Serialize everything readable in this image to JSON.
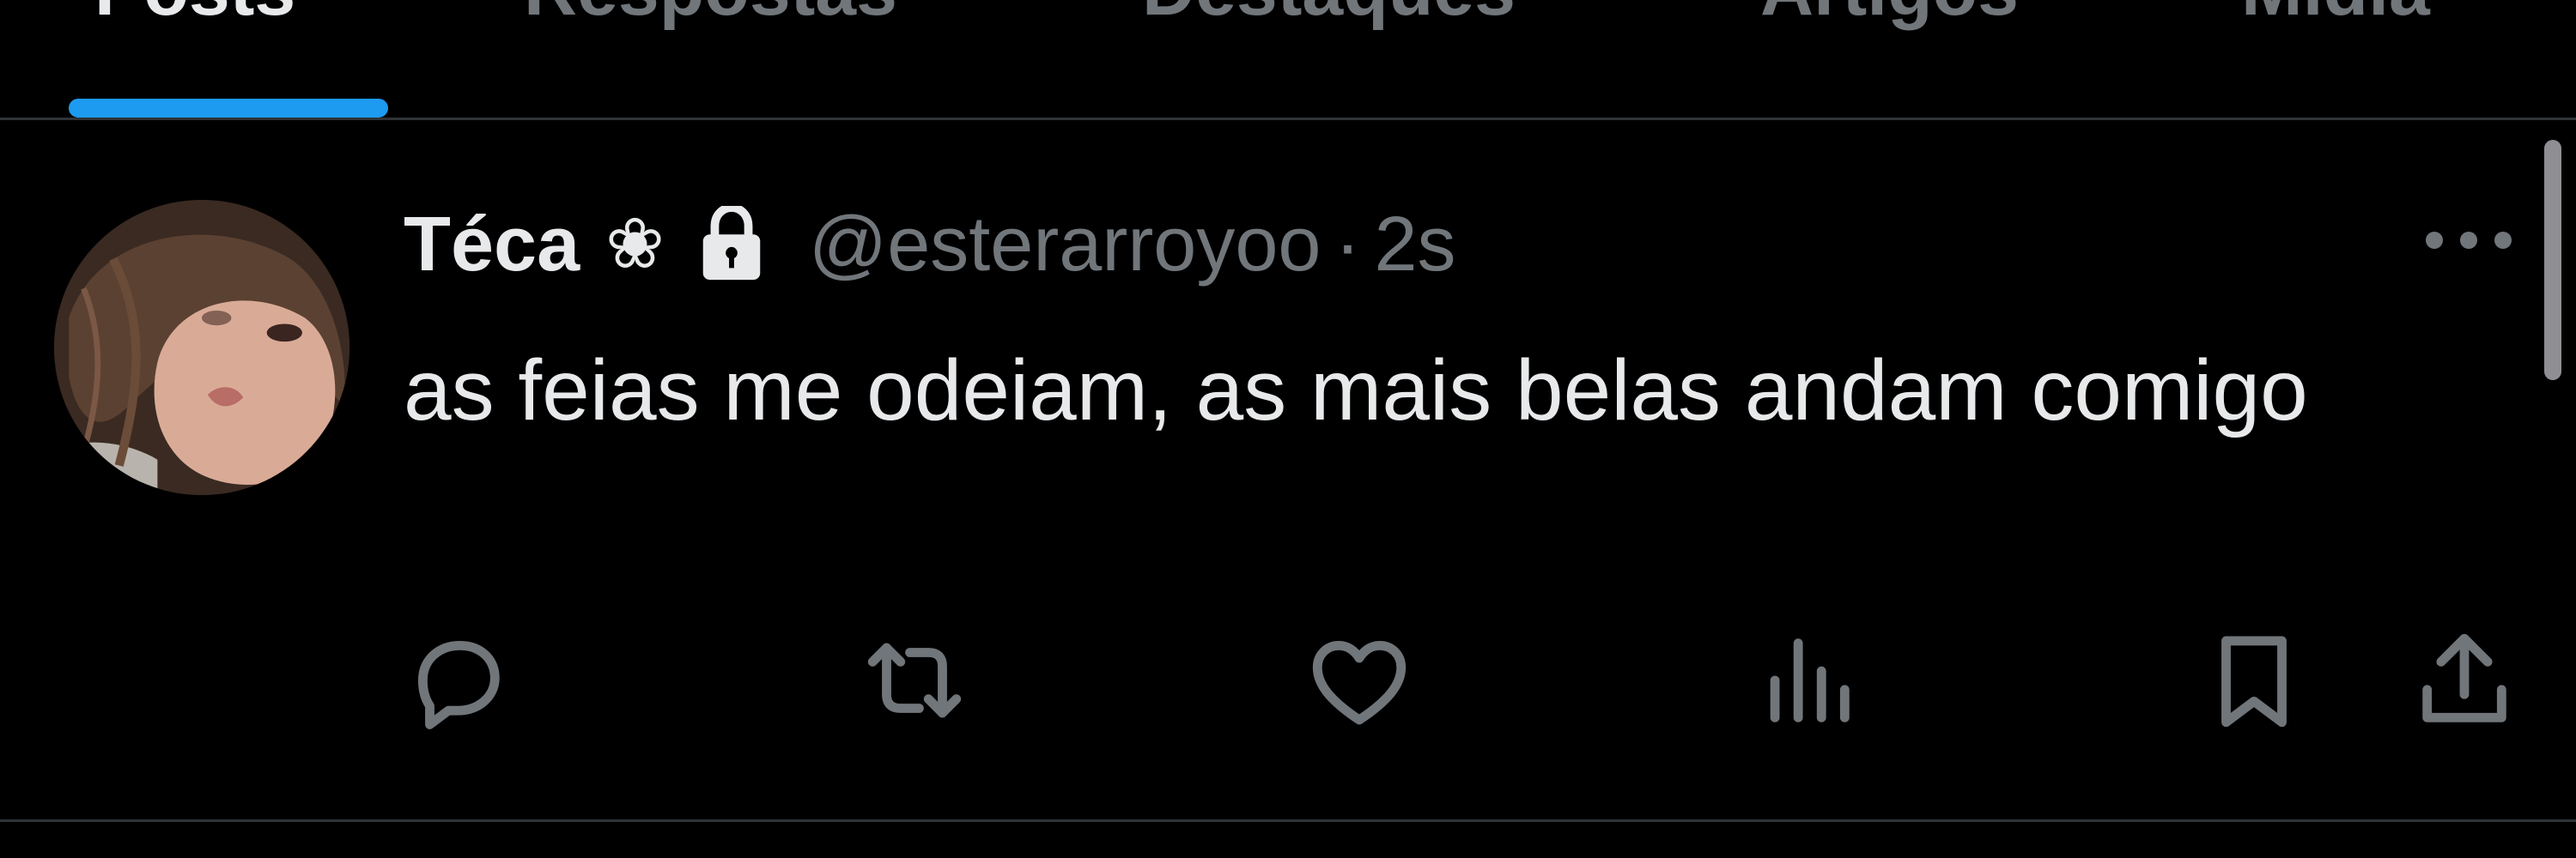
{
  "tabs": [
    {
      "label": "Posts",
      "active": true
    },
    {
      "label": "Respostas",
      "active": false
    },
    {
      "label": "Destaques",
      "active": false
    },
    {
      "label": "Artigos",
      "active": false
    },
    {
      "label": "Mídia",
      "active": false
    }
  ],
  "colors": {
    "background": "#000000",
    "accent": "#1d9bf0",
    "primary_text": "#e7e9ea",
    "secondary_text": "#71767b",
    "divider": "#2f3336"
  },
  "post": {
    "display_name": "Téca",
    "name_emoji": "❀",
    "protected_icon": "lock-icon",
    "handle": "@esterarroyoo",
    "separator": "·",
    "timestamp": "2s",
    "text": "as feias me odeiam, as mais belas andam comigo",
    "more_icon": "more-horizontal-icon",
    "actions": [
      {
        "name": "reply",
        "icon": "reply-icon"
      },
      {
        "name": "repost",
        "icon": "repost-icon"
      },
      {
        "name": "like",
        "icon": "heart-icon"
      },
      {
        "name": "views",
        "icon": "analytics-icon"
      },
      {
        "name": "bookmark",
        "icon": "bookmark-icon"
      },
      {
        "name": "share",
        "icon": "share-icon"
      }
    ]
  }
}
